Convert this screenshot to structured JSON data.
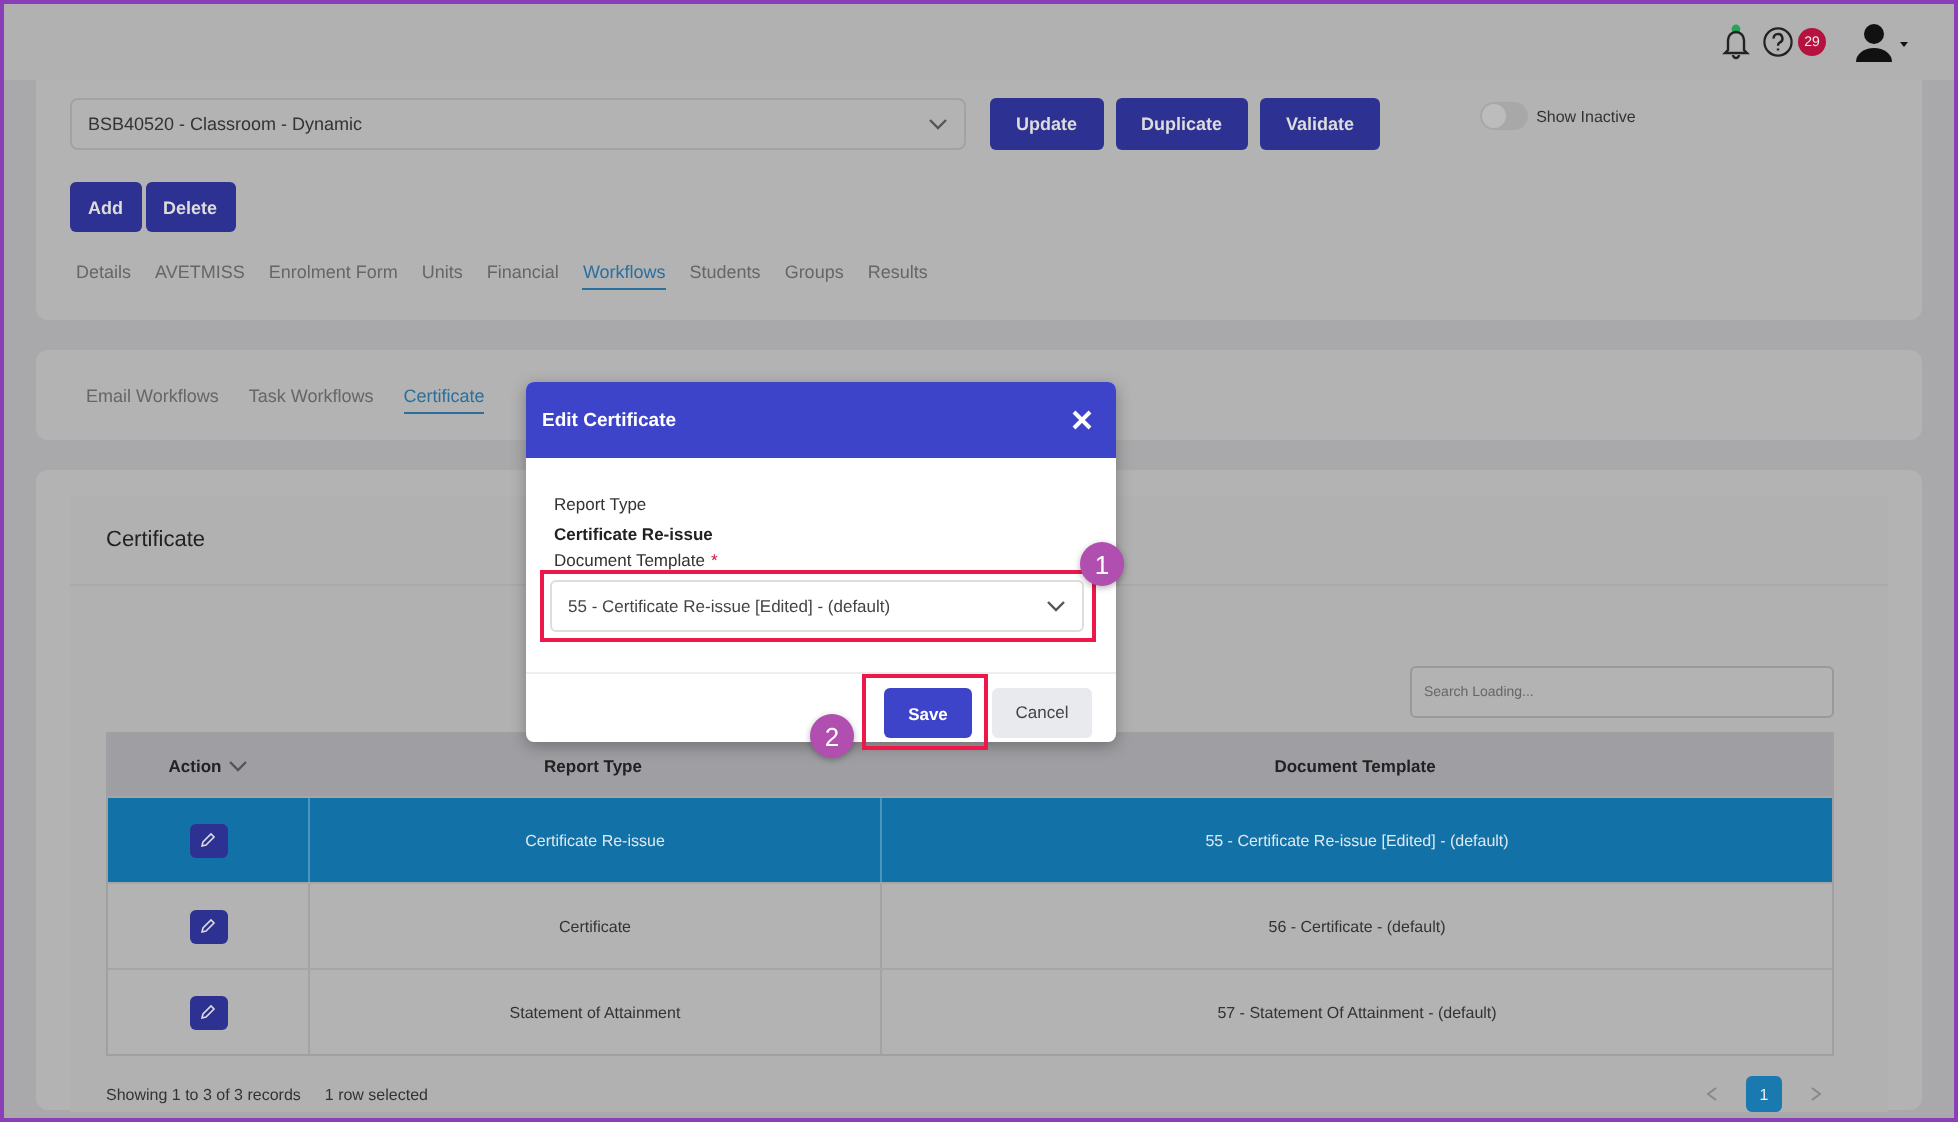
{
  "header": {
    "notification_dot": true,
    "help_count": "29"
  },
  "course_select": {
    "value": "BSB40520 - Classroom - Dynamic"
  },
  "top_buttons": [
    "Update",
    "Duplicate",
    "Validate"
  ],
  "show_inactive": {
    "label": "Show Inactive",
    "on": false
  },
  "action_buttons": [
    "Add",
    "Delete"
  ],
  "tabs": [
    {
      "label": "Details",
      "selected": false
    },
    {
      "label": "AVETMISS",
      "selected": false
    },
    {
      "label": "Enrolment Form",
      "selected": false
    },
    {
      "label": "Units",
      "selected": false
    },
    {
      "label": "Financial",
      "selected": false
    },
    {
      "label": "Workflows",
      "selected": true
    },
    {
      "label": "Students",
      "selected": false
    },
    {
      "label": "Groups",
      "selected": false
    },
    {
      "label": "Results",
      "selected": false
    }
  ],
  "sub_tabs": [
    {
      "label": "Email Workflows",
      "selected": false
    },
    {
      "label": "Task Workflows",
      "selected": false
    },
    {
      "label": "Certificate",
      "selected": true
    }
  ],
  "panel": {
    "title": "Certificate",
    "search": {
      "placeholder": "Search Loading..."
    },
    "table": {
      "columns": [
        "Action",
        "Report Type",
        "Document Template"
      ],
      "rows": [
        {
          "report_type": "Certificate Re-issue",
          "document_template": "55 - Certificate Re-issue [Edited] - (default)",
          "selected": true
        },
        {
          "report_type": "Certificate",
          "document_template": "56 - Certificate - (default)",
          "selected": false
        },
        {
          "report_type": "Statement of Attainment",
          "document_template": "57 - Statement Of Attainment - (default)",
          "selected": false
        }
      ]
    },
    "records": "Showing 1 to 3 of 3 records",
    "selection": "1 row selected",
    "pages": [
      {
        "label": "1",
        "selected": true
      }
    ]
  },
  "modal": {
    "title": "Edit Certificate",
    "report_type_label": "Report Type",
    "report_type_value": "Certificate Re-issue",
    "template_label": "Document Template",
    "template_required_mark": "*",
    "template_value": "55 - Certificate Re-issue [Edited] - (default)",
    "save": "Save",
    "cancel": "Cancel"
  },
  "callouts": [
    {
      "number": "1"
    },
    {
      "number": "2"
    }
  ]
}
